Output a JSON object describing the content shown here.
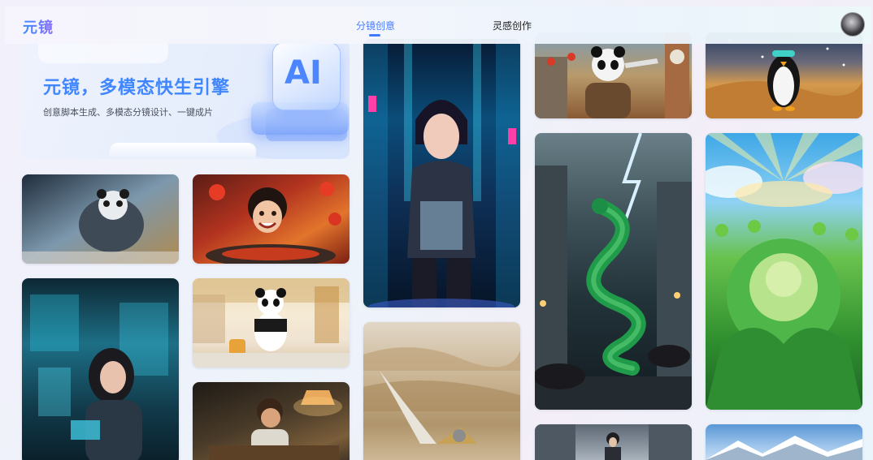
{
  "app": {
    "logo": "元镜"
  },
  "nav": {
    "tabs": [
      {
        "label": "分镜创意",
        "active": true
      },
      {
        "label": "灵感创作",
        "active": false
      }
    ]
  },
  "banner": {
    "title": "元镜，多模态快生引擎",
    "subtitle": "创意脚本生成、多模态分镜设计、一键成片",
    "badge": "AI"
  },
  "gallery": {
    "items": [
      {
        "id": "mech-panda-forest",
        "icon": "image-icon"
      },
      {
        "id": "girl-eating-noodles",
        "icon": "image-icon"
      },
      {
        "id": "cyberpunk-girl",
        "icon": "image-icon"
      },
      {
        "id": "panda-sailor-city",
        "icon": "image-icon"
      },
      {
        "id": "penguin-desert",
        "icon": "image-icon"
      },
      {
        "id": "cyber-girl-lab",
        "icon": "image-icon"
      },
      {
        "id": "panda-airport",
        "icon": "image-icon"
      },
      {
        "id": "green-dragon-storm",
        "icon": "image-icon"
      },
      {
        "id": "giant-cabbage-field",
        "icon": "image-icon"
      },
      {
        "id": "desert-dunes-eagle",
        "icon": "image-icon"
      },
      {
        "id": "boy-desk-lamp",
        "icon": "image-icon"
      },
      {
        "id": "man-snow-street",
        "icon": "image-icon"
      },
      {
        "id": "snowy-mountains",
        "icon": "image-icon"
      }
    ]
  },
  "colors": {
    "accent": "#3f7bff",
    "title_blue": "#3f86ff"
  }
}
